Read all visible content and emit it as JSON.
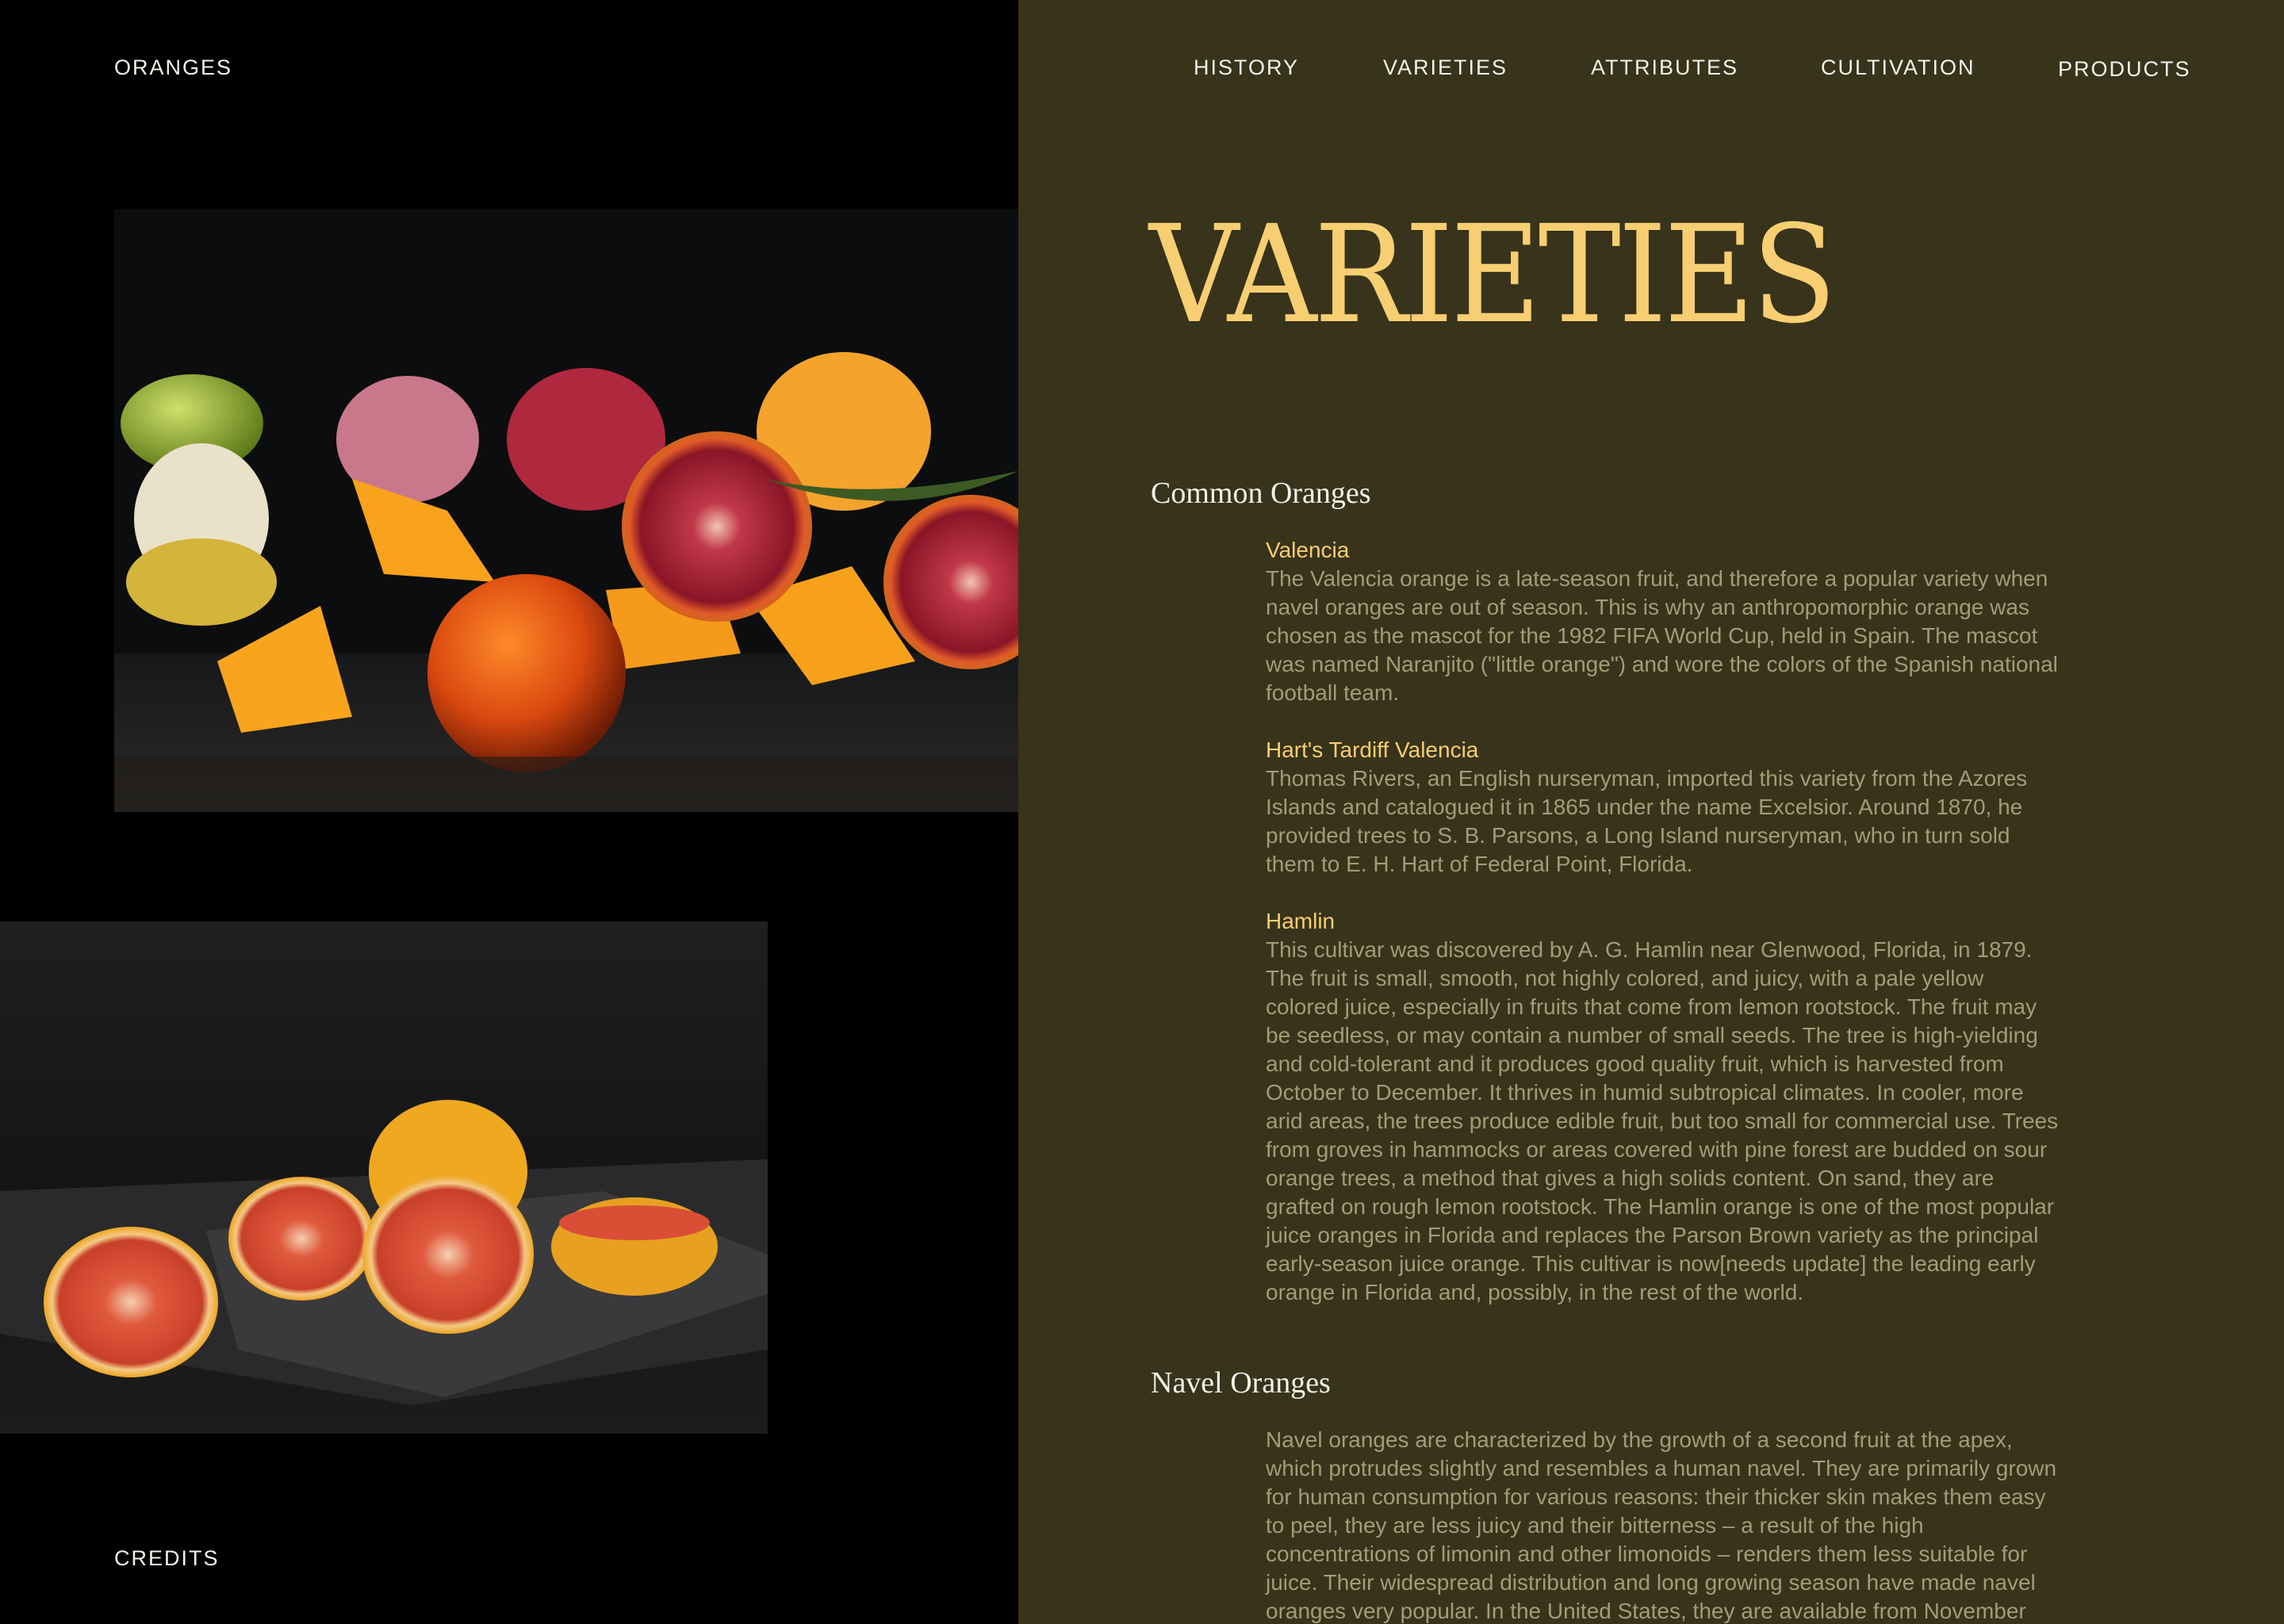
{
  "site": {
    "logo": "ORANGES",
    "credits": "CREDITS"
  },
  "nav": [
    {
      "label": "HISTORY"
    },
    {
      "label": "VARIETIES"
    },
    {
      "label": "ATTRIBUTES"
    },
    {
      "label": "CULTIVATION"
    },
    {
      "label": "PRODUCTS"
    }
  ],
  "page_title": "VARIETIES",
  "sections": [
    {
      "title": "Common Oranges",
      "entries": [
        {
          "name": "Valencia",
          "body": "The Valencia orange is a late-season fruit, and therefore a popular variety when navel oranges are out of season. This is why an anthropomorphic orange was chosen as the mascot for the 1982 FIFA World Cup, held in Spain. The mascot was named Naranjito (\"little orange\") and wore the colors of the Spanish national football team."
        },
        {
          "name": "Hart's Tardiff Valencia",
          "body": "Thomas Rivers, an English nurseryman, imported this variety from the Azores Islands and catalogued it in 1865 under the name Excelsior. Around 1870, he provided trees to S. B. Parsons, a Long Island nurseryman, who in turn sold them to E. H. Hart of Federal Point, Florida."
        },
        {
          "name": "Hamlin",
          "body": "This cultivar was discovered by A. G. Hamlin near Glenwood, Florida, in 1879. The fruit is small, smooth, not highly colored, and juicy, with a pale yellow colored juice, especially in fruits that come from lemon rootstock. The fruit may be seedless, or may contain a number of small seeds. The tree is high-yielding and cold-tolerant and it produces good quality fruit, which is harvested from October to December. It thrives in humid subtropical climates. In cooler, more arid areas, the trees produce edible fruit, but too small for commercial use. Trees from groves in hammocks or areas covered with pine forest are budded on sour orange trees, a method that gives a high solids content. On sand, they are grafted on rough lemon rootstock. The Hamlin orange is one of the most popular juice oranges in Florida and replaces the Parson Brown variety as the principal early-season juice orange. This cultivar is now[needs update] the leading early orange in Florida and, possibly, in the rest of the world."
        }
      ]
    },
    {
      "title": "Navel Oranges",
      "entries": [
        {
          "name": "",
          "body": "Navel oranges are characterized by the growth of a second fruit at the apex, which protrudes slightly and resembles a human navel. They are primarily grown for human consumption for various reasons: their thicker skin makes them easy to peel, they are less juicy and their bitterness – a result of the high concentrations of limonin and other limonoids – renders them less suitable for juice. Their widespread distribution and long growing season have made navel oranges very popular. In the United States, they are available from November"
        }
      ]
    }
  ],
  "colors": {
    "left_background": "#000000",
    "right_background": "#38331b",
    "title_accent": "#f7cf72",
    "body_text": "#a39c78",
    "nav_text": "#f4f1e8"
  },
  "images": [
    {
      "name": "cut-oranges-photo",
      "subject": "peeled and sliced blood oranges, limes and oranges on dark wood"
    },
    {
      "name": "grapefruit-photo",
      "subject": "halved grapefruits on dark slate"
    }
  ]
}
